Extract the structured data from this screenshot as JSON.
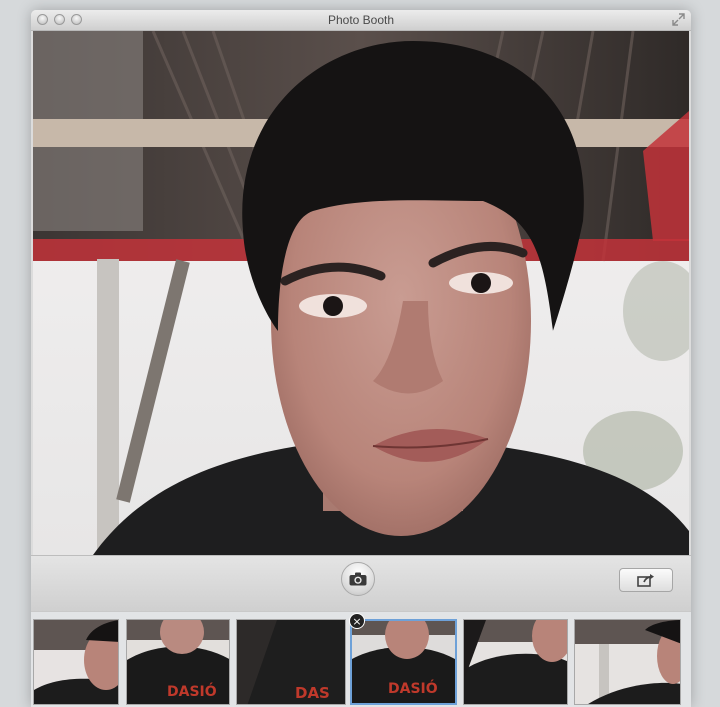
{
  "window": {
    "title": "Photo Booth"
  },
  "toolbar": {
    "shutter_icon": "camera-icon",
    "share_icon": "share-icon"
  },
  "filmstrip": {
    "thumbnails": [
      {
        "id": 1,
        "selected": false,
        "shirt_text": ""
      },
      {
        "id": 2,
        "selected": false,
        "shirt_text": "DASIÓ"
      },
      {
        "id": 3,
        "selected": false,
        "shirt_text": "DAS"
      },
      {
        "id": 4,
        "selected": true,
        "shirt_text": "DASIÓ"
      },
      {
        "id": 5,
        "selected": false,
        "shirt_text": ""
      },
      {
        "id": 6,
        "selected": false,
        "shirt_text": ""
      }
    ],
    "delete_glyph": "×"
  },
  "colors": {
    "accent_selected": "#6ea1d8",
    "roof_red": "#c2333a",
    "shirt_text_red": "#c0392b"
  }
}
